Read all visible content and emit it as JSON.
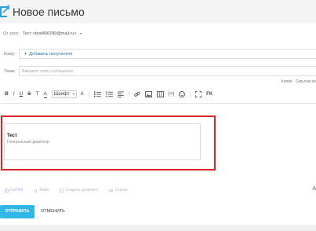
{
  "header": {
    "title": "Новое письмо"
  },
  "from": {
    "label": "От кого:",
    "value": "Тест <test456789@mail.ru>"
  },
  "to": {
    "label": "Кому:",
    "add_recipients": "Добавить получателя"
  },
  "subject": {
    "label": "Тема:",
    "placeholder": "Введите тему сообщения"
  },
  "copies": {
    "cc": "Копия",
    "bcc": "Скрытая ко"
  },
  "toolbar": {
    "bold": "B",
    "italic": "I",
    "underline": "U",
    "strike": "S",
    "clear": "T",
    "align": "A",
    "font": "Шрифт",
    "size": "A",
    "code": "{>}",
    "clean": "FK"
  },
  "signature": {
    "name": "Тест",
    "position": "Генеральный директор"
  },
  "attachments": {
    "copilot": "CoPilot",
    "file": "Файл",
    "create_doc": "Создать документ",
    "links": "Ссылы"
  },
  "tail_label": "A",
  "actions": {
    "send": "ОТПРАВИТЬ",
    "cancel": "ОТМЕНИТЬ"
  },
  "colors": {
    "accent": "#30b7e6",
    "link": "#2a6fb0",
    "highlight": "#d9262a"
  }
}
